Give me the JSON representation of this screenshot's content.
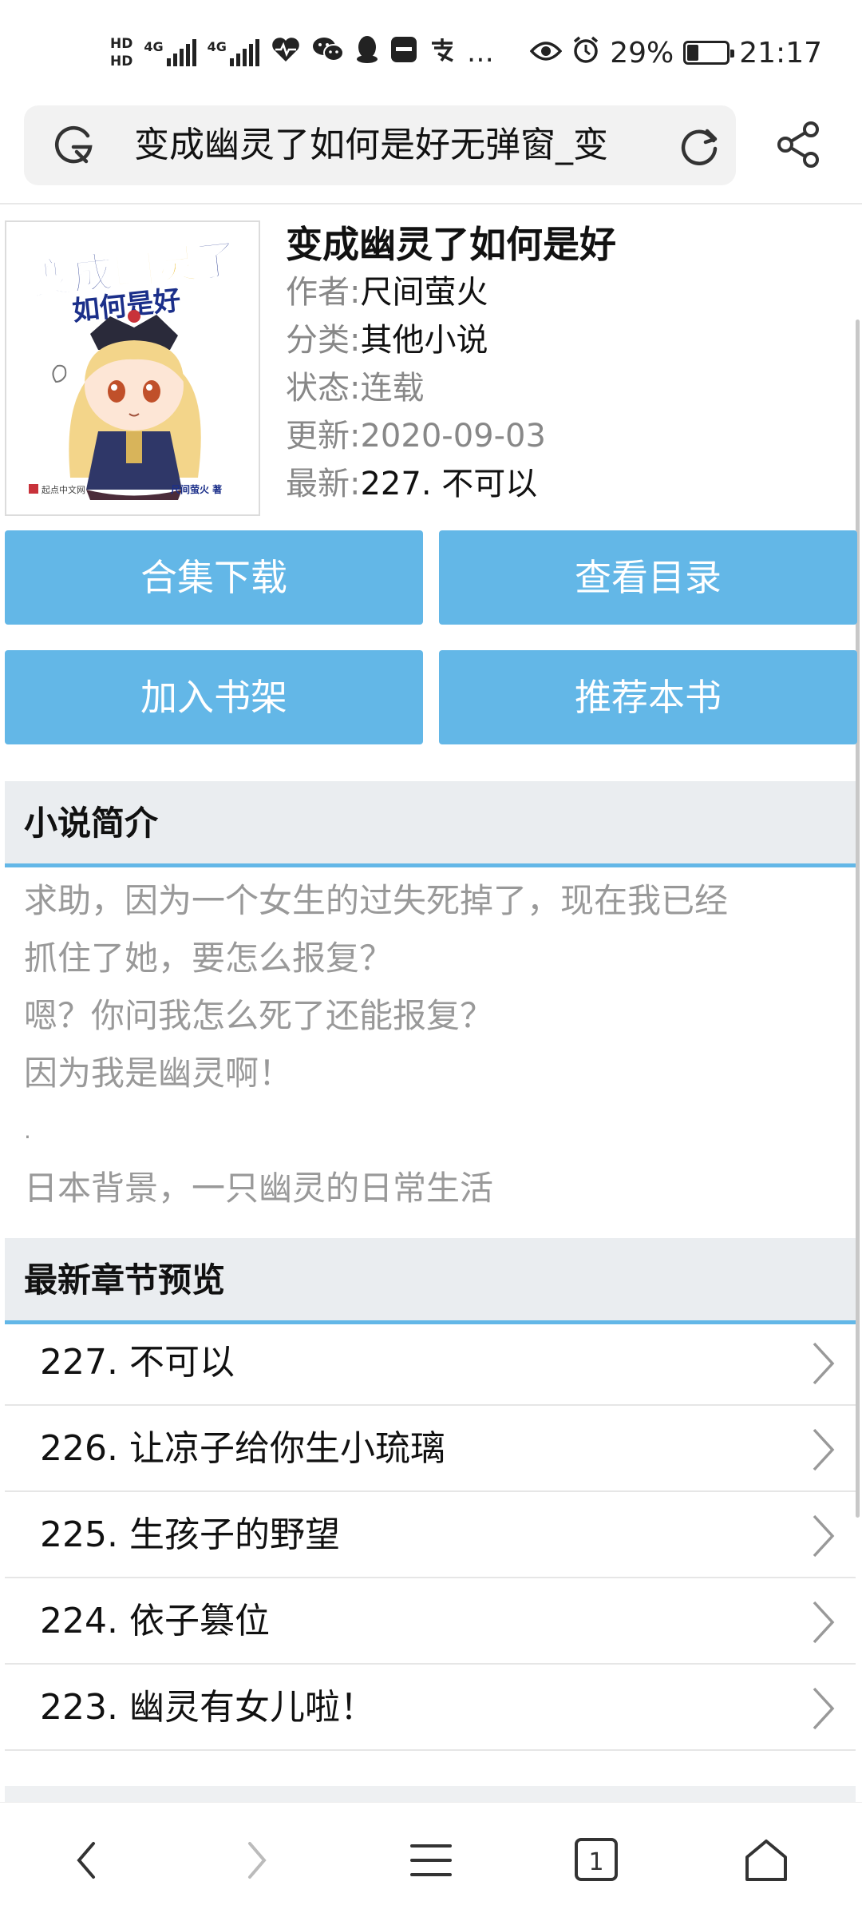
{
  "status_bar": {
    "hd1": "HD",
    "hd2": "HD",
    "net1": "4G",
    "net2": "4G",
    "battery_percent": "29%",
    "battery_level": 0.29,
    "time": "21:17",
    "more": "…"
  },
  "address_bar": {
    "text": "变成幽灵了如何是好无弹窗_变"
  },
  "book": {
    "title": "变成幽灵了如何是好",
    "author_label": "作者:",
    "author": "尺间萤火",
    "category_label": "分类:",
    "category": "其他小说",
    "status_label": "状态:",
    "status": "连载",
    "updated_label": "更新:",
    "updated": "2020-09-03",
    "latest_label": "最新:",
    "latest": "227. 不可以",
    "cover": {
      "title_line1_a": "变成",
      "title_line1_b": "幽灵",
      "title_line1_c": "了",
      "title_line2": "如何是好",
      "publisher": "起点中文网",
      "author_tag": "尺间萤火 著"
    }
  },
  "buttons": {
    "download": "合集下载",
    "catalog": "查看目录",
    "add_shelf": "加入书架",
    "recommend": "推荐本书"
  },
  "intro": {
    "heading": "小说简介",
    "lines": [
      "求助，因为一个女生的过失死掉了，现在我已经",
      "抓住了她，要怎么报复？",
      "嗯？你问我怎么死了还能报复？",
      "因为我是幽灵啊！",
      ".",
      "日本背景，一只幽灵的日常生活"
    ]
  },
  "chapters": {
    "heading": "最新章节预览",
    "items": [
      "227. 不可以",
      "226. 让凉子给你生小琉璃",
      "225. 生孩子的野望",
      "224. 依子篡位",
      "223. 幽灵有女儿啦！"
    ]
  },
  "bottom_nav": {
    "tab_count": "1"
  },
  "colors": {
    "accent": "#63b7e7",
    "section_bg": "#eaedf0",
    "muted_text": "#999999"
  }
}
